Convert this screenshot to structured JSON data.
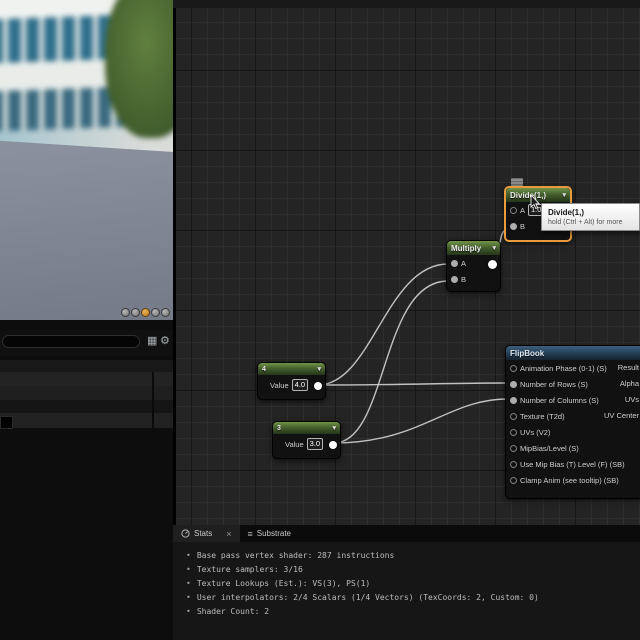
{
  "icons": {
    "chevron_down": "▾",
    "close": "×",
    "grid": "▦",
    "gear": "⚙",
    "substrate_list": "≡",
    "bullet": "•"
  },
  "viewport": {
    "shape_buttons": [
      {
        "name": "cylinder"
      },
      {
        "name": "sphere"
      },
      {
        "name": "plane"
      },
      {
        "name": "cube"
      },
      {
        "name": "mesh"
      }
    ],
    "selected_shape_color": "#c9882a"
  },
  "left_panel": {
    "search": {
      "value": "",
      "placeholder": ""
    }
  },
  "graph": {
    "nodes": {
      "divide": {
        "title": "Divide(1,)",
        "pin_a": "A",
        "pin_b": "B",
        "a_value": "1.0"
      },
      "multiply": {
        "title": "Multiply",
        "pin_a": "A",
        "pin_b": "B"
      },
      "const4": {
        "title": "4",
        "value_label": "Value",
        "value": "4.0"
      },
      "const3": {
        "title": "3",
        "value_label": "Value",
        "value": "3.0"
      },
      "flipbook": {
        "title": "FlipBook",
        "inputs": [
          "Animation Phase (0-1) (S)",
          "Number of Rows (S)",
          "Number of Columns (S)",
          "Texture (T2d)",
          "UVs (V2)",
          "MipBias/Level (S)",
          "Use Mip Bias (T) Level (F) (SB)",
          "Clamp Anim (see tooltip) (SB)"
        ],
        "outputs": [
          "Result",
          "Alpha",
          "UVs",
          "UV Center"
        ]
      }
    },
    "tooltip": {
      "title": "Divide(1,)",
      "subtitle": "hold (Ctrl + Alt) for more"
    }
  },
  "stats_panel": {
    "tabs": [
      {
        "label": "Stats"
      },
      {
        "label": "Substrate"
      }
    ],
    "lines": [
      "Base pass vertex shader: 287 instructions",
      "Texture samplers: 3/16",
      "Texture Lookups (Est.): VS(3), PS(1)",
      "User interpolators: 2/4 Scalars (1/4 Vectors) (TexCoords: 2, Custom: 0)",
      "Shader Count: 2"
    ]
  },
  "colors": {
    "selection_orange": "#e89c3c",
    "wire": "#cfcfcf",
    "const_header_green": "#5c7e3c",
    "flipbook_header_blue": "#34536e",
    "graph_bg": "#242424"
  }
}
